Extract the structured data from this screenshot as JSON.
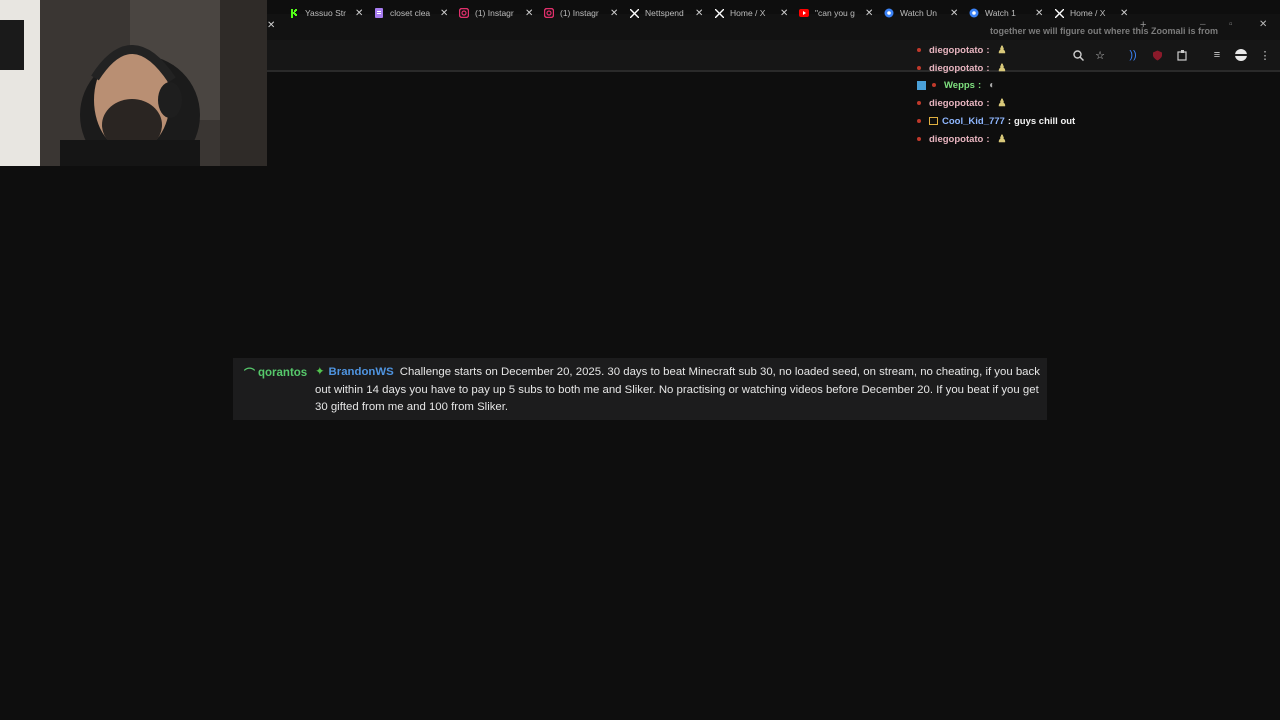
{
  "tabs": [
    {
      "title": "Yassuo Str",
      "icon": "kick-icon",
      "color": "#53fc18"
    },
    {
      "title": "closet clea",
      "icon": "doc-icon",
      "color": "#a77cf0"
    },
    {
      "title": "(1) Instagr",
      "icon": "instagram-icon",
      "color": "#e1306c"
    },
    {
      "title": "(1) Instagr",
      "icon": "instagram-icon",
      "color": "#e1306c"
    },
    {
      "title": "Nettspend",
      "icon": "x-logo-icon",
      "color": "#ffffff"
    },
    {
      "title": "Home / X",
      "icon": "x-logo-icon",
      "color": "#ffffff"
    },
    {
      "title": "\"can you g",
      "icon": "youtube-icon",
      "color": "#ff0000"
    },
    {
      "title": "Watch Un",
      "icon": "watch-icon",
      "color": "#3b82f6"
    },
    {
      "title": "Watch 1",
      "icon": "watch-icon",
      "color": "#3b82f6"
    },
    {
      "title": "Home / X",
      "icon": "x-logo-icon",
      "color": "#ffffff"
    }
  ],
  "chat": {
    "faded_message": "together we will figure out where this Zoomali is from",
    "lines": [
      {
        "user": "diegopotato",
        "text": "",
        "emote": "potato-emote"
      },
      {
        "user": "diegopotato",
        "text": "",
        "emote": "potato-emote"
      },
      {
        "user": "Wepps",
        "text": "",
        "emote": "mouse-emote",
        "user_color": "#7fe07f"
      },
      {
        "user": "diegopotato",
        "text": "",
        "emote": "potato-emote"
      },
      {
        "user": "Cool_Kid_777",
        "text": "guys chill out",
        "emote": "",
        "user_color": "#8fb7ff"
      },
      {
        "user": "diegopotato",
        "text": "",
        "emote": "potato-emote"
      }
    ]
  },
  "pinned": {
    "author": "qorantos",
    "mention": "BrandonWS",
    "message": "Challenge starts on December 20, 2025. 30 days to beat Minecraft sub 30, no loaded seed, on stream, no cheating, if you back out within 14 days you have to pay up 5 subs to both me and Sliker. No practising or watching videos before December 20. If you beat if you get 30 gifted from me and 100 from Sliker."
  },
  "colors": {
    "background": "#0e0e0e",
    "pinned_bg": "#1c1c1d",
    "author_green": "#56c86b",
    "mention_blue": "#4f94e0",
    "chat_name_pink": "#e8b5c0"
  }
}
